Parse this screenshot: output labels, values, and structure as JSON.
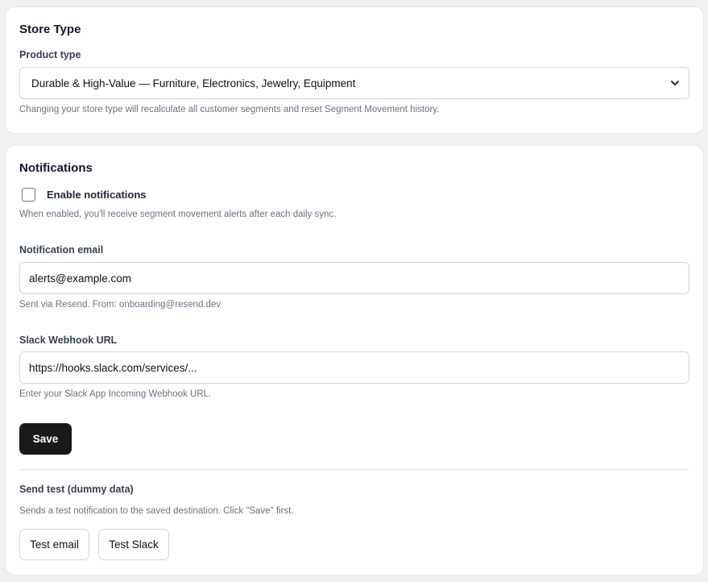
{
  "store_type": {
    "title": "Store Type",
    "product_type_label": "Product type",
    "product_type_value": "Durable & High-Value — Furniture, Electronics, Jewelry, Equipment",
    "help": "Changing your store type will recalculate all customer segments and reset Segment Movement history."
  },
  "notifications": {
    "title": "Notifications",
    "enable_label": "Enable notifications",
    "enable_checked": false,
    "enable_help": "When enabled, you'll receive segment movement alerts after each daily sync.",
    "email_label": "Notification email",
    "email_value": "alerts@example.com",
    "email_help": "Sent via Resend. From: onboarding@resend.dev",
    "slack_label": "Slack Webhook URL",
    "slack_value": "https://hooks.slack.com/services/...",
    "slack_help": "Enter your Slack App Incoming Webhook URL.",
    "save_label": "Save",
    "test_title": "Send test (dummy data)",
    "test_help": "Sends a test notification to the saved destination. Click \"Save\" first.",
    "test_email_label": "Test email",
    "test_slack_label": "Test Slack"
  },
  "icons": {
    "select_chevron": "chevron-down-icon",
    "checkbox": "checkbox-unchecked-icon"
  },
  "colors": {
    "primary_button": "#1a1a1a",
    "background": "#f1f1f1"
  }
}
